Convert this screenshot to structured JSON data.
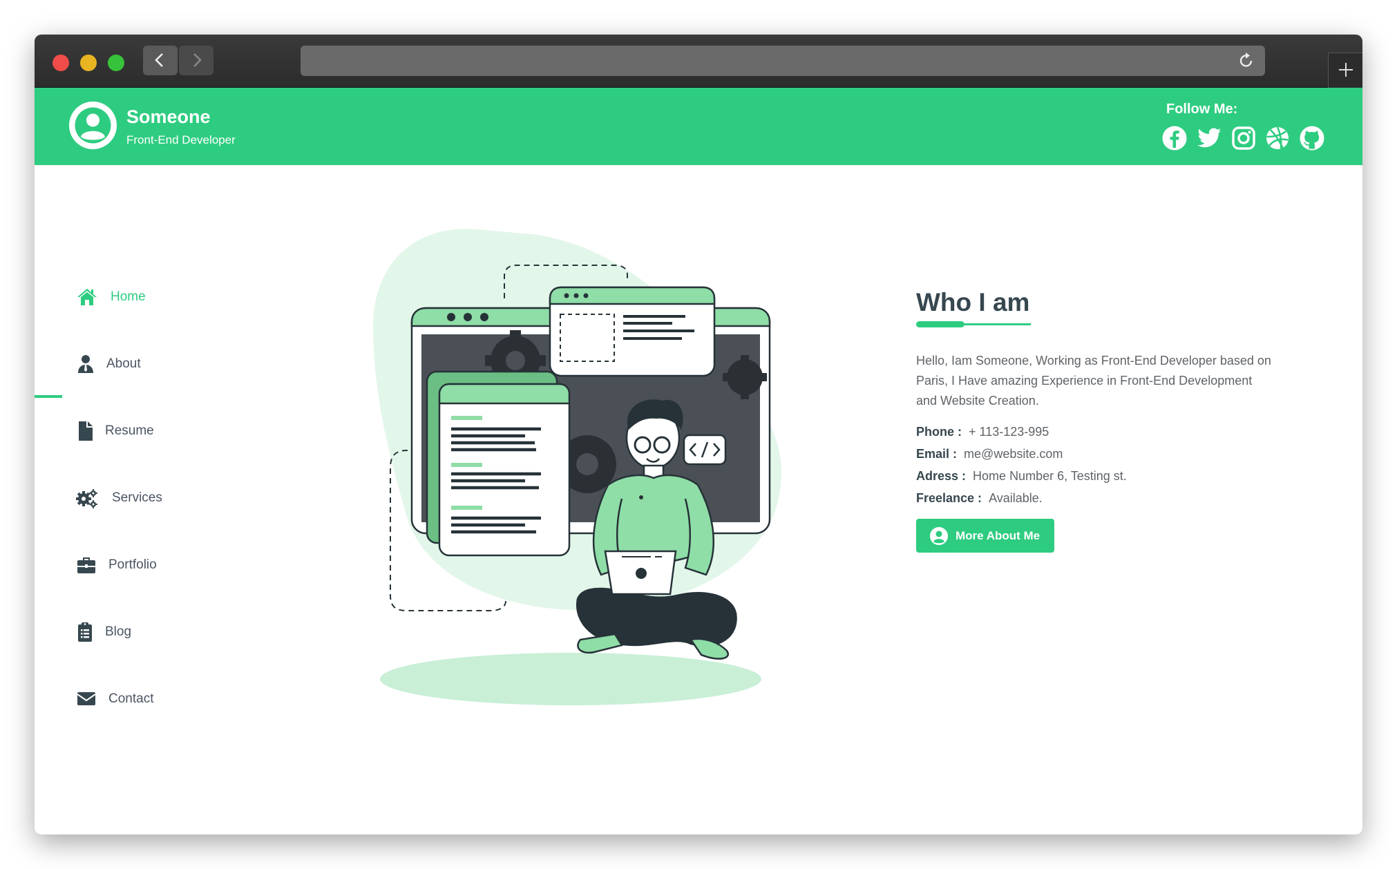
{
  "header": {
    "name": "Someone",
    "role": "Front-End Developer",
    "follow_label": "Follow Me:",
    "social": [
      "facebook-icon",
      "twitter-icon",
      "instagram-icon",
      "dribbble-icon",
      "github-icon"
    ]
  },
  "sidebar": {
    "items": [
      {
        "label": "Home",
        "icon": "home-icon",
        "active": true
      },
      {
        "label": "About",
        "icon": "user-tie-icon"
      },
      {
        "label": "Resume",
        "icon": "file-icon"
      },
      {
        "label": "Services",
        "icon": "gears-icon"
      },
      {
        "label": "Portfolio",
        "icon": "briefcase-icon"
      },
      {
        "label": "Blog",
        "icon": "clipboard-list-icon"
      },
      {
        "label": "Contact",
        "icon": "envelope-icon"
      }
    ]
  },
  "about": {
    "title": "Who I am",
    "bio": "Hello, Iam Someone, Working as Front-End Developer based on Paris, I Have amazing Experience in Front-End Development and Website Creation.",
    "phone_label": "Phone :",
    "phone": "+ 113-123-995",
    "email_label": "Email :",
    "email": "me@website.com",
    "address_label": "Adress :",
    "address": "Home Number 6, Testing st.",
    "freelance_label": "Freelance :",
    "freelance": "Available.",
    "button_label": "More About Me"
  },
  "colors": {
    "accent": "#2ecc80",
    "text_dark": "#37474f",
    "text": "#5f6368"
  }
}
